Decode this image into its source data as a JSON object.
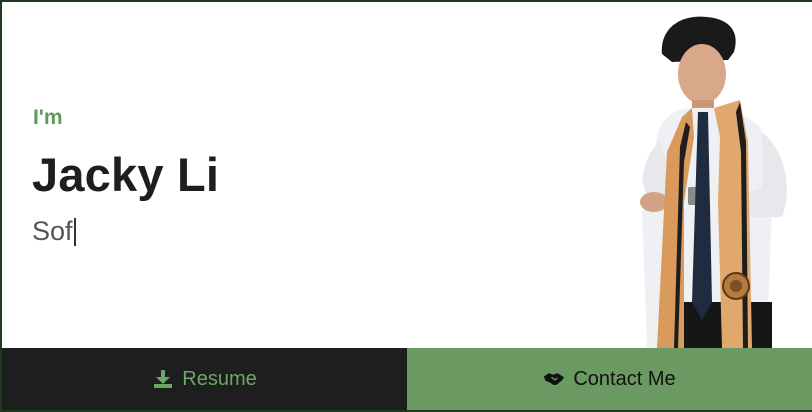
{
  "hero": {
    "intro": "I'm",
    "name": "Jacky Li",
    "typed_text": "Sof"
  },
  "actions": {
    "resume_label": "Resume",
    "contact_label": "Contact Me"
  },
  "colors": {
    "accent_green": "#6a9a62",
    "dark": "#1e1e1e",
    "frame": "#1f3a1f"
  },
  "icons": {
    "resume": "download-icon",
    "contact": "handshake-icon"
  }
}
